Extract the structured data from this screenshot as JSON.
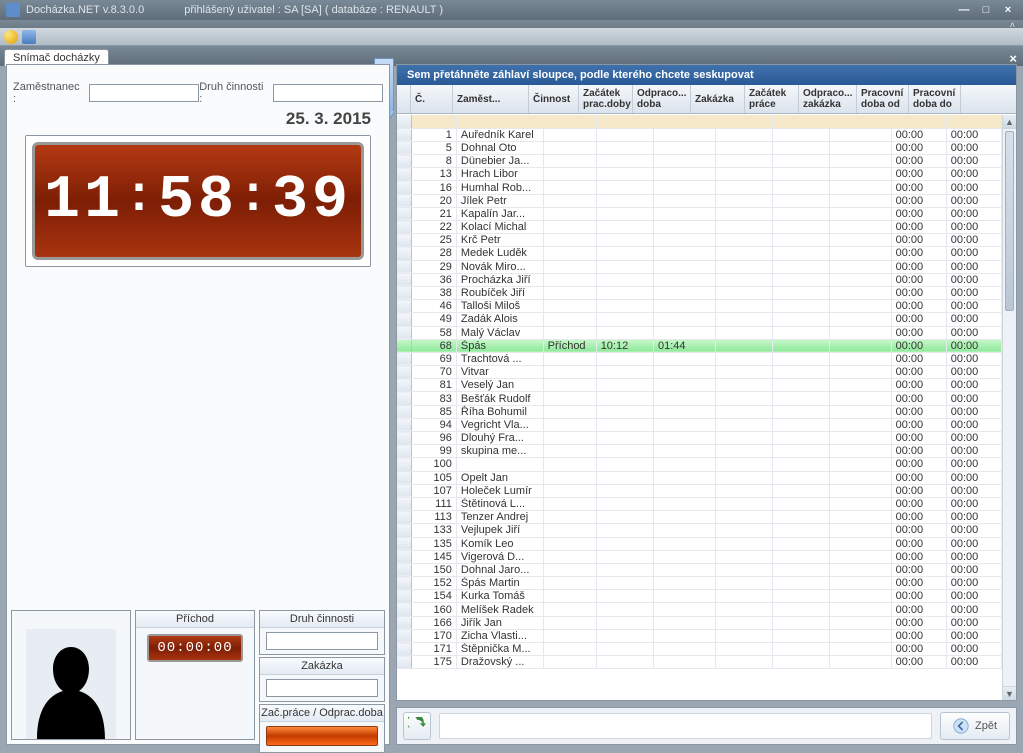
{
  "window": {
    "app_title": "Docházka.NET v.8.3.0.0",
    "user_info": "přihlášený uživatel : SA [SA] ( databáze : RENAULT )",
    "min": "―",
    "max": "□",
    "close": "×",
    "chevron": "˄"
  },
  "tab": {
    "label": "Snímač docházky",
    "close": "×"
  },
  "filters": {
    "employee_label": "Zaměstnanec :",
    "employee_value": "",
    "activity_label": "Druh činnosti :",
    "activity_value": ""
  },
  "date": "25. 3. 2015",
  "clock": {
    "h": "11",
    "m": "58",
    "s": "39"
  },
  "bottomleft": {
    "prichod_label": "Příchod",
    "prichod_value": "00:00:00",
    "druh_label": "Druh činnosti",
    "zakazka_label": "Zakázka",
    "zac_label": "Zač.práce / Odprac.doba"
  },
  "grid": {
    "group_hint": "Sem přetáhněte záhlaví sloupce, podle kterého chcete seskupovat",
    "cols": [
      "Č.",
      "Zaměst...",
      "Činnost",
      "Začátek prac.doby",
      "Odpraco... doba",
      "Zakázka",
      "Začátek práce",
      "Odpraco... zakázka",
      "Pracovní doba od",
      "Pracovní doba do"
    ],
    "rows": [
      {
        "n": 1,
        "name": "Auředník Karel",
        "od": "00:00",
        "do": "00:00"
      },
      {
        "n": 5,
        "name": "Dohnal Oto",
        "od": "00:00",
        "do": "00:00"
      },
      {
        "n": 8,
        "name": "Dünebier Ja...",
        "od": "00:00",
        "do": "00:00"
      },
      {
        "n": 13,
        "name": "Hrach Libor",
        "od": "00:00",
        "do": "00:00"
      },
      {
        "n": 16,
        "name": "Humhal Rob...",
        "od": "00:00",
        "do": "00:00"
      },
      {
        "n": 20,
        "name": "Jílek Petr",
        "od": "00:00",
        "do": "00:00"
      },
      {
        "n": 21,
        "name": "Kapalín Jar...",
        "od": "00:00",
        "do": "00:00"
      },
      {
        "n": 22,
        "name": "Kolací Michal",
        "od": "00:00",
        "do": "00:00"
      },
      {
        "n": 25,
        "name": "Krč Petr",
        "od": "00:00",
        "do": "00:00"
      },
      {
        "n": 28,
        "name": "Medek Luděk",
        "od": "00:00",
        "do": "00:00"
      },
      {
        "n": 29,
        "name": "Novák Miro...",
        "od": "00:00",
        "do": "00:00"
      },
      {
        "n": 36,
        "name": "Procházka Jiří",
        "od": "00:00",
        "do": "00:00"
      },
      {
        "n": 38,
        "name": "Roubíček Jiří",
        "od": "00:00",
        "do": "00:00"
      },
      {
        "n": 46,
        "name": "Talloši Miloš",
        "od": "00:00",
        "do": "00:00"
      },
      {
        "n": 49,
        "name": "Zadák Alois",
        "od": "00:00",
        "do": "00:00"
      },
      {
        "n": 58,
        "name": "Malý Václav",
        "od": "00:00",
        "do": "00:00"
      },
      {
        "n": 68,
        "name": "Špás",
        "cinnost": "Příchod",
        "start": "10:12",
        "doba": "01:44",
        "od": "00:00",
        "do": "00:00",
        "hl": true
      },
      {
        "n": 69,
        "name": "Trachtová ...",
        "od": "00:00",
        "do": "00:00"
      },
      {
        "n": 70,
        "name": "Vitvar",
        "od": "00:00",
        "do": "00:00"
      },
      {
        "n": 81,
        "name": "Veselý Jan",
        "od": "00:00",
        "do": "00:00"
      },
      {
        "n": 83,
        "name": "Bešťák Rudolf",
        "od": "00:00",
        "do": "00:00"
      },
      {
        "n": 85,
        "name": "Říha Bohumil",
        "od": "00:00",
        "do": "00:00"
      },
      {
        "n": 94,
        "name": "Vegricht Vla...",
        "od": "00:00",
        "do": "00:00"
      },
      {
        "n": 96,
        "name": "Dlouhý Fra...",
        "od": "00:00",
        "do": "00:00"
      },
      {
        "n": 99,
        "name": "skupina me...",
        "od": "00:00",
        "do": "00:00"
      },
      {
        "n": 100,
        "name": "",
        "od": "00:00",
        "do": "00:00"
      },
      {
        "n": 105,
        "name": "Opelt Jan",
        "od": "00:00",
        "do": "00:00"
      },
      {
        "n": 107,
        "name": "Holeček Lumír",
        "od": "00:00",
        "do": "00:00"
      },
      {
        "n": 111,
        "name": "Štětinová L...",
        "od": "00:00",
        "do": "00:00"
      },
      {
        "n": 113,
        "name": "Tenzer Andrej",
        "od": "00:00",
        "do": "00:00"
      },
      {
        "n": 133,
        "name": "Vejlupek Jiří",
        "od": "00:00",
        "do": "00:00"
      },
      {
        "n": 135,
        "name": "Komík Leo",
        "od": "00:00",
        "do": "00:00"
      },
      {
        "n": 145,
        "name": "Vigerová D...",
        "od": "00:00",
        "do": "00:00"
      },
      {
        "n": 150,
        "name": "Dohnal Jaro...",
        "od": "00:00",
        "do": "00:00"
      },
      {
        "n": 152,
        "name": "Špás Martin",
        "od": "00:00",
        "do": "00:00"
      },
      {
        "n": 154,
        "name": "Kurka Tomáš",
        "od": "00:00",
        "do": "00:00"
      },
      {
        "n": 160,
        "name": "Melíšek Radek",
        "od": "00:00",
        "do": "00:00"
      },
      {
        "n": 166,
        "name": "Jiřík Jan",
        "od": "00:00",
        "do": "00:00"
      },
      {
        "n": 170,
        "name": "Zicha Vlasti...",
        "od": "00:00",
        "do": "00:00"
      },
      {
        "n": 171,
        "name": "Štěpnička M...",
        "od": "00:00",
        "do": "00:00"
      },
      {
        "n": 175,
        "name": "Dražovský ...",
        "od": "00:00",
        "do": "00:00"
      }
    ]
  },
  "backbtn": "Zpět"
}
